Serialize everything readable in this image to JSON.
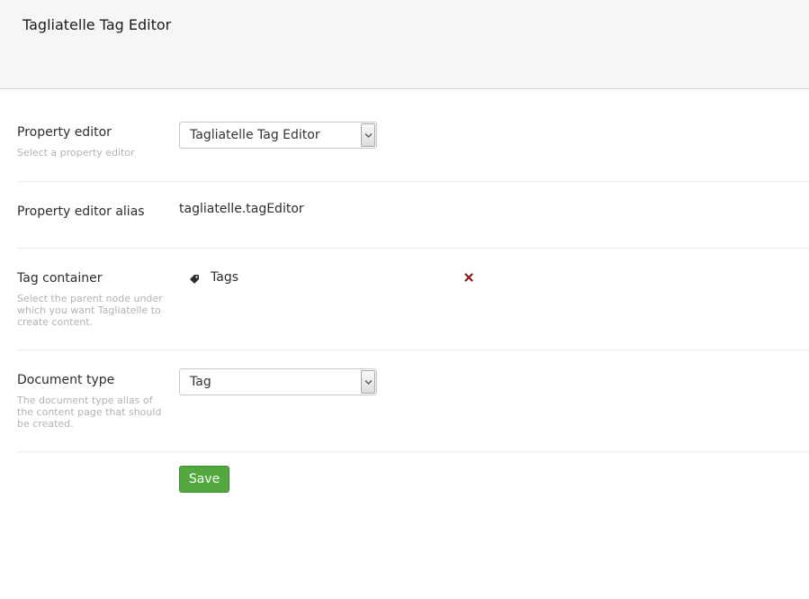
{
  "header": {
    "title": "Tagliatelle Tag Editor"
  },
  "fields": {
    "property_editor": {
      "label": "Property editor",
      "description": "Select a property editor",
      "value": "Tagliatelle Tag Editor"
    },
    "property_editor_alias": {
      "label": "Property editor alias",
      "value": "tagliatelle.tagEditor"
    },
    "tag_container": {
      "label": "Tag container",
      "description": "Select the parent node under which you want Tagliatelle to create content.",
      "selected_node": "Tags",
      "icons": {
        "node": "tag-icon",
        "remove": "close-icon"
      },
      "remove_color": "#8b1a1a"
    },
    "document_type": {
      "label": "Document type",
      "description": "The document type alias of the content page that should be created.",
      "value": "Tag"
    }
  },
  "actions": {
    "save_label": "Save",
    "save_color": "#53a93f"
  }
}
